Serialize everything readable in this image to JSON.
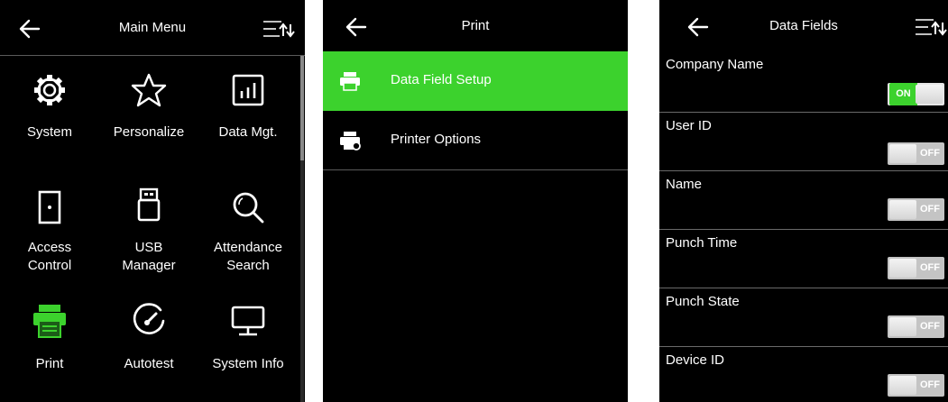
{
  "main_menu": {
    "title": "Main Menu",
    "items": [
      {
        "label": "System",
        "icon": "gear-icon"
      },
      {
        "label": "Personalize",
        "icon": "star-icon"
      },
      {
        "label": "Data Mgt.",
        "icon": "chart-icon"
      },
      {
        "label": "Access\nControl",
        "icon": "door-icon"
      },
      {
        "label": "USB\nManager",
        "icon": "usb-icon"
      },
      {
        "label": "Attendance\nSearch",
        "icon": "search-icon"
      },
      {
        "label": "Print",
        "icon": "printer-icon"
      },
      {
        "label": "Autotest",
        "icon": "gauge-icon"
      },
      {
        "label": "System Info",
        "icon": "monitor-icon"
      }
    ]
  },
  "print": {
    "title": "Print",
    "items": [
      {
        "label": "Data Field Setup",
        "selected": true,
        "icon": "printer-icon"
      },
      {
        "label": "Printer Options",
        "selected": false,
        "icon": "printer-settings-icon"
      }
    ]
  },
  "data_fields": {
    "title": "Data Fields",
    "fields": [
      {
        "label": "Company Name",
        "state": "ON"
      },
      {
        "label": "User ID",
        "state": "OFF"
      },
      {
        "label": "Name",
        "state": "OFF"
      },
      {
        "label": "Punch Time",
        "state": "OFF"
      },
      {
        "label": "Punch State",
        "state": "OFF"
      },
      {
        "label": "Device ID",
        "state": "OFF"
      }
    ]
  },
  "colors": {
    "background": "#000000",
    "highlight": "#3cd22d",
    "divider": "#5a5a5a",
    "toggle_off": "#c4c4c4"
  }
}
